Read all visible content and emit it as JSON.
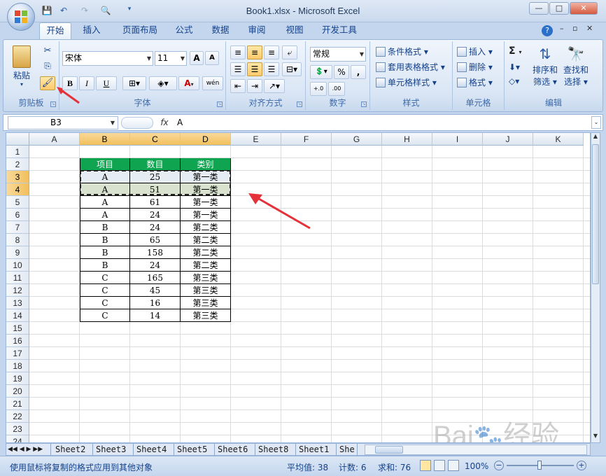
{
  "window": {
    "title": "Book1.xlsx - Microsoft Excel",
    "controls": [
      "—",
      "□",
      "✕"
    ]
  },
  "ribbon_tabs": [
    "开始",
    "插入",
    "页面布局",
    "公式",
    "数据",
    "审阅",
    "视图",
    "开发工具"
  ],
  "active_tab": "开始",
  "ribbon": {
    "clipboard": {
      "label": "剪贴板",
      "paste": "粘贴"
    },
    "font": {
      "label": "字体",
      "font_name": "宋体",
      "font_size": "11",
      "bold": "B",
      "italic": "I",
      "underline": "U",
      "grow": "A",
      "color_a": "A",
      "phonetic": "wén"
    },
    "alignment": {
      "label": "对齐方式"
    },
    "number": {
      "label": "数字",
      "format": "常规",
      "percent": "%",
      "comma": ",",
      "inc": "+.0",
      "dec": ".00"
    },
    "styles": {
      "label": "样式",
      "items": [
        "条件格式",
        "套用表格格式",
        "单元格样式"
      ]
    },
    "cells": {
      "label": "单元格",
      "items": [
        "插入",
        "删除",
        "格式"
      ]
    },
    "editing": {
      "label": "编辑",
      "sort": "排序和",
      "sort2": "筛选",
      "find": "查找和",
      "find2": "选择",
      "sigma": "Σ"
    }
  },
  "formula_bar": {
    "name_box": "B3",
    "fx": "fx",
    "content": "A"
  },
  "columns": [
    "A",
    "B",
    "C",
    "D",
    "E",
    "F",
    "G",
    "H",
    "I",
    "J",
    "K"
  ],
  "selected_columns": [
    "B",
    "C",
    "D"
  ],
  "rows": [
    "1",
    "2",
    "3",
    "4",
    "5",
    "6",
    "7",
    "8",
    "9",
    "10",
    "11",
    "12",
    "13",
    "14",
    "15",
    "16",
    "17",
    "18",
    "19",
    "20",
    "21",
    "22",
    "23",
    "24"
  ],
  "selected_rows": [
    "3",
    "4"
  ],
  "table": {
    "headers": [
      "项目",
      "数目",
      "类别"
    ],
    "rows": [
      [
        "A",
        "25",
        "第一类"
      ],
      [
        "A",
        "51",
        "第一类"
      ],
      [
        "A",
        "61",
        "第一类"
      ],
      [
        "A",
        "24",
        "第一类"
      ],
      [
        "B",
        "24",
        "第二类"
      ],
      [
        "B",
        "65",
        "第二类"
      ],
      [
        "B",
        "158",
        "第二类"
      ],
      [
        "B",
        "24",
        "第二类"
      ],
      [
        "C",
        "165",
        "第三类"
      ],
      [
        "C",
        "45",
        "第三类"
      ],
      [
        "C",
        "16",
        "第三类"
      ],
      [
        "C",
        "14",
        "第三类"
      ]
    ]
  },
  "sheet_tabs": [
    "Sheet2",
    "Sheet3",
    "Sheet4",
    "Sheet5",
    "Sheet6",
    "Sheet8",
    "Sheet1",
    "She"
  ],
  "status": {
    "message": "使用鼠标将复制的格式应用到其他对象",
    "average": "平均值: 38",
    "count": "计数: 6",
    "sum": "求和: 76",
    "zoom": "100%"
  },
  "colors": {
    "header_green": "#0fa44f",
    "selection_orange": "#f1c05c",
    "arrow_red": "#e5323a"
  }
}
